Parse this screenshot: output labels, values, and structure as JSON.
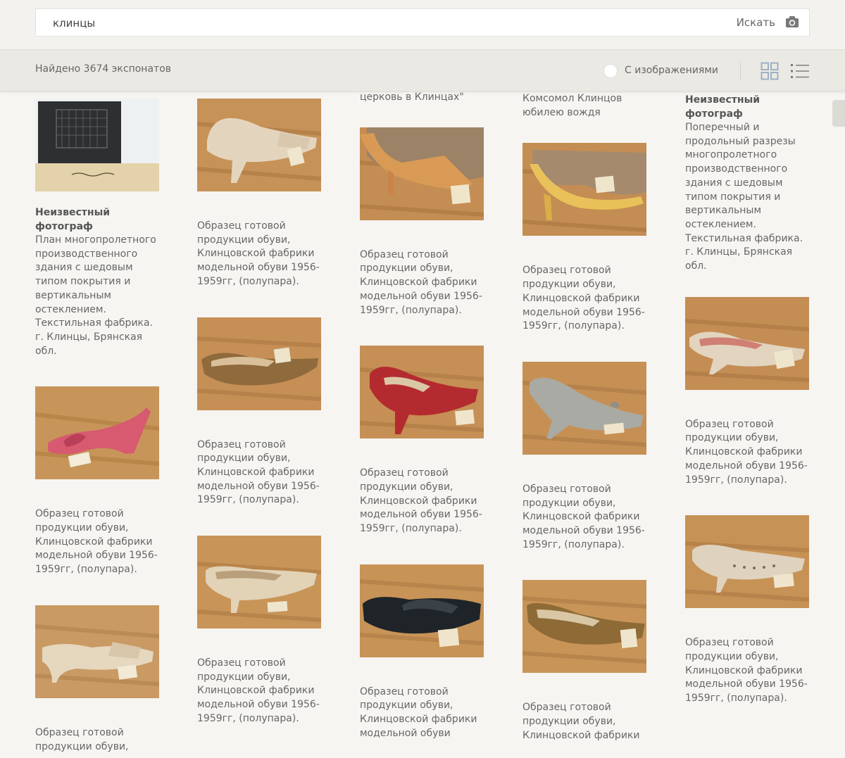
{
  "search": {
    "value": "клинцы",
    "button_label": "Искать"
  },
  "results_bar": {
    "found_text": "Найдено 3674 экспонатов",
    "images_toggle_label": "С изображениями"
  },
  "icons": {
    "camera": "camera-icon",
    "grid_view": "grid-view-icon",
    "list_view": "list-view-icon"
  },
  "colors": {
    "background": "#f6f5f2",
    "bar": "#ebe9e4",
    "text": "#666666",
    "view_icon": "#9fb0c3"
  },
  "columns": [
    {
      "top_text": "",
      "cards": [
        {
          "author": "Неизвестный фотограф",
          "description": "План многопролетного производственного здания с шедовым типом покрытия и вертикальным остеклением. Текстильная фабрика. г. Клинцы, Брянская обл.",
          "image": "architectural-plan-photo"
        },
        {
          "author": "",
          "description": "Образец готовой продукции обуви, Клинцовской фабрики модельной обуви 1956-1959гг, (полупара).",
          "image": "pink-shoe-photo"
        },
        {
          "author": "",
          "description": "Образец готовой продукции обуви,",
          "image": "beige-perforated-shoe-photo"
        }
      ]
    },
    {
      "top_text": "",
      "cards": [
        {
          "author": "",
          "description": "Образец готовой продукции обуви, Клинцовской фабрики модельной обуви 1956-1959гг, (полупара).",
          "image": "beige-perforated-shoe-photo"
        },
        {
          "author": "",
          "description": "Образец готовой продукции обуви, Клинцовской фабрики модельной обуви 1956-1959гг, (полупара).",
          "image": "brown-shoe-photo"
        },
        {
          "author": "",
          "description": "Образец готовой продукции обуви, Клинцовской фабрики модельной обуви 1956-1959гг, (полупара).",
          "image": "cream-shoe-photo"
        }
      ]
    },
    {
      "top_text": "церковь в Клинцах\"",
      "cards": [
        {
          "author": "",
          "description": "Образец готовой продукции обуви, Клинцовской фабрики модельной обуви 1956-1959гг, (полупара).",
          "image": "tan-sandal-photo"
        },
        {
          "author": "",
          "description": "Образец готовой продукции обуви, Клинцовской фабрики модельной обуви 1956-1959гг, (полупара).",
          "image": "red-shoe-photo"
        },
        {
          "author": "",
          "description": "Образец готовой продукции обуви, Клинцовской фабрики модельной обуви",
          "image": "black-shoe-photo"
        }
      ]
    },
    {
      "top_text": "Комсомол Клинцов юбилею вождя",
      "cards": [
        {
          "author": "",
          "description": "Образец готовой продукции обуви, Клинцовской фабрики модельной обуви 1956-1959гг, (полупара).",
          "image": "yellow-sandal-photo"
        },
        {
          "author": "",
          "description": "Образец готовой продукции обуви, Клинцовской фабрики модельной обуви 1956-1959гг, (полупара).",
          "image": "grey-shoe-photo"
        },
        {
          "author": "",
          "description": "Образец готовой продукции обуви, Клинцовской фабрики",
          "image": "olive-shoe-photo"
        }
      ]
    },
    {
      "top_text": "",
      "cards": [
        {
          "author": "Неизвестный фотограф",
          "description": "Поперечный и продольный разрезы многопролетного производственного здания с шедовым типом покрытия и вертикальным остеклением. Текстильная фабрика. г. Клинцы, Брянская обл.",
          "image": "none"
        },
        {
          "author": "",
          "description": "Образец готовой продукции обуви, Клинцовской фабрики модельной обуви 1956-1959гг, (полупара).",
          "image": "beige-bow-shoe-photo"
        },
        {
          "author": "",
          "description": "Образец готовой продукции обуви, Клинцовской фабрики модельной обуви 1956-1959гг, (полупара).",
          "image": "light-perforated-shoe-photo"
        }
      ]
    }
  ]
}
